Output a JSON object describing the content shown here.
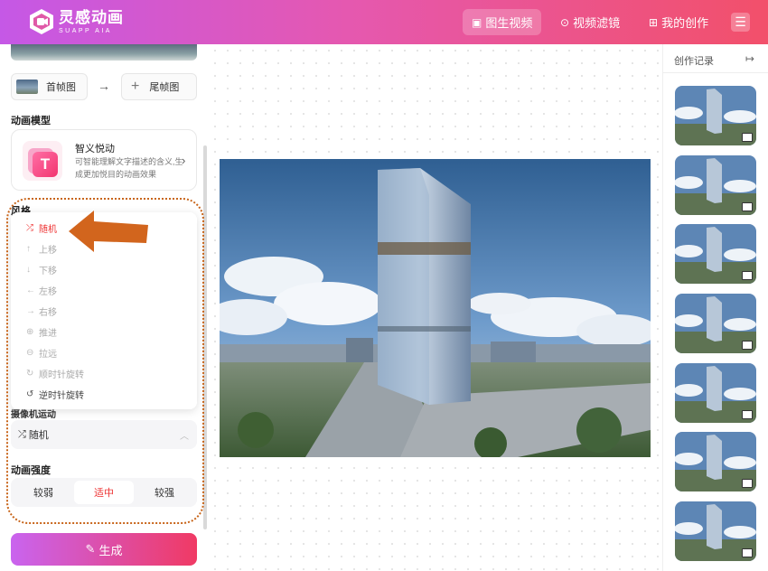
{
  "header": {
    "logo_cn": "灵感动画",
    "logo_en": "SUAPP AIA",
    "nav": [
      {
        "label": "图生视频",
        "icon": "image-icon",
        "active": true
      },
      {
        "label": "视频滤镜",
        "icon": "play-icon",
        "active": false
      },
      {
        "label": "我的创作",
        "icon": "grid-icon",
        "active": false
      }
    ],
    "menu_icon": "☰"
  },
  "left": {
    "first_frame_label": "首帧图",
    "arrow": "→",
    "last_frame_label": "尾帧图",
    "plus": "+",
    "model_section": "动画模型",
    "model": {
      "name": "智义悦动",
      "desc": "可智能理解文字描述的含义,生成更加悦目的动画效果",
      "chevron": "›"
    },
    "style_section": "风格",
    "styles": [
      {
        "icon": "⤮",
        "label": "随机"
      },
      {
        "icon": "↑",
        "label": "上移"
      },
      {
        "icon": "↓",
        "label": "下移"
      },
      {
        "icon": "←",
        "label": "左移"
      },
      {
        "icon": "→",
        "label": "右移"
      },
      {
        "icon": "⊕",
        "label": "推进"
      },
      {
        "icon": "⊖",
        "label": "拉远"
      },
      {
        "icon": "↻",
        "label": "顺时针旋转"
      },
      {
        "icon": "↺",
        "label": "逆时针旋转"
      }
    ],
    "selected_style": "随机",
    "partial_label": "摄像机运动",
    "select_value": "随机",
    "select_icon": "⤮",
    "select_caret": "︿",
    "intensity_section": "动画强度",
    "intensity": [
      "较弱",
      "适中",
      "较强"
    ],
    "intensity_selected": "适中",
    "generate_label": "生成",
    "generate_icon": "✎"
  },
  "right": {
    "title": "创作记录",
    "collapse_icon": "↦"
  },
  "colors": {
    "header_start": "#c558e6",
    "header_end": "#f2506a",
    "accent": "#e33333",
    "annotation": "#c8651a"
  }
}
